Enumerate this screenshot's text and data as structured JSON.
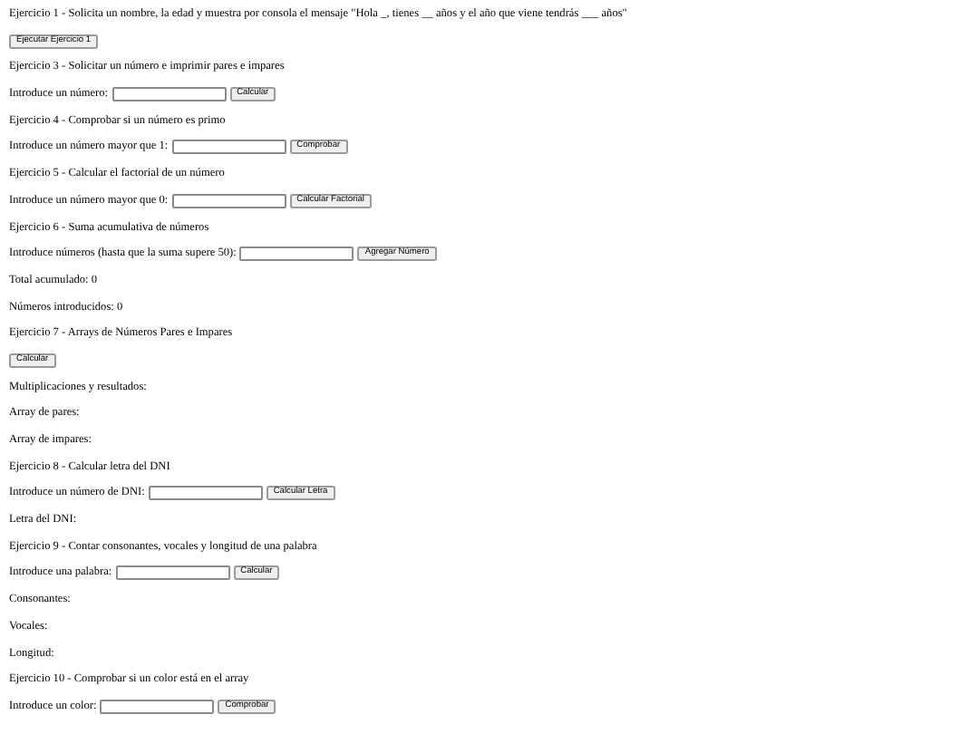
{
  "blocks": [
    {
      "kind": "text",
      "text": "Ejercicio 1 - Solicita un nombre, la edad y muestra por consola el mensaje \"Hola _, tienes __ años y el año que viene tendrás ___ años\""
    },
    {
      "kind": "button",
      "button": "Ejecutar Ejercicio 1"
    },
    {
      "kind": "text",
      "text": "Ejercicio 3 - Solicitar un número e imprimir pares e impares"
    },
    {
      "kind": "field",
      "label": "Introduce un número:",
      "button": "Calcular"
    },
    {
      "kind": "text",
      "text": "Ejercicio 4 - Comprobar si un número es primo"
    },
    {
      "kind": "field",
      "label": "Introduce un número mayor que 1:",
      "button": "Comprobar"
    },
    {
      "kind": "text",
      "text": "Ejercicio 5 - Calcular el factorial de un número"
    },
    {
      "kind": "field",
      "label": "Introduce un número mayor que 0:",
      "button": "Calcular Factorial"
    },
    {
      "kind": "text",
      "text": "Ejercicio 6 - Suma acumulativa de números"
    },
    {
      "kind": "field",
      "label": "Introduce números (hasta que la suma supere 50):",
      "button": "Agregar Número"
    },
    {
      "kind": "text",
      "text": "Total acumulado: 0"
    },
    {
      "kind": "text",
      "text": "Números introducidos: 0"
    },
    {
      "kind": "text",
      "text": "Ejercicio 7 - Arrays de Números Pares e Impares"
    },
    {
      "kind": "button",
      "button": "Calcular"
    },
    {
      "kind": "text",
      "text": "Multiplicaciones y resultados:"
    },
    {
      "kind": "text",
      "text": "Array de pares:"
    },
    {
      "kind": "text",
      "text": "Array de impares:"
    },
    {
      "kind": "text",
      "text": "Ejercicio 8 - Calcular letra del DNI"
    },
    {
      "kind": "field",
      "label": "Introduce un número de DNI:",
      "button": "Calcular Letra"
    },
    {
      "kind": "text",
      "text": "Letra del DNI:"
    },
    {
      "kind": "text",
      "text": "Ejercicio 9 - Contar consonantes, vocales y longitud de una palabra"
    },
    {
      "kind": "field",
      "label": "Introduce una palabra:",
      "button": "Calcular"
    },
    {
      "kind": "text",
      "text": "Consonantes:"
    },
    {
      "kind": "text",
      "text": "Vocales:"
    },
    {
      "kind": "text",
      "text": "Longitud:"
    },
    {
      "kind": "text",
      "text": "Ejercicio 10 - Comprobar si un color está en el array"
    },
    {
      "kind": "field",
      "label": "Introduce un color:",
      "button": "Comprobar"
    }
  ]
}
